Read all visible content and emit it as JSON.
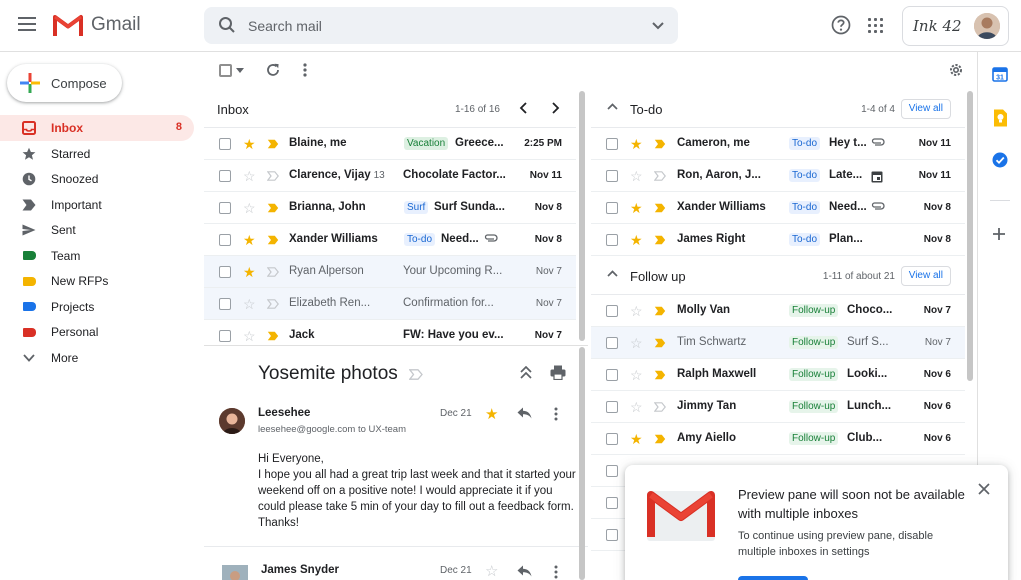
{
  "header": {
    "app_name": "Gmail",
    "search_placeholder": "Search mail",
    "account_brand": "Ink 42"
  },
  "compose_label": "Compose",
  "nav": [
    {
      "label": "Inbox",
      "count": "8",
      "icon": "inbox-icon",
      "active": true
    },
    {
      "label": "Starred",
      "count": "",
      "icon": "star-icon"
    },
    {
      "label": "Snoozed",
      "count": "",
      "icon": "clock-icon"
    },
    {
      "label": "Important",
      "count": "",
      "icon": "important-icon"
    },
    {
      "label": "Sent",
      "count": "",
      "icon": "send-icon"
    },
    {
      "label": "Team",
      "count": "",
      "icon": "label-icon",
      "color": "#188038"
    },
    {
      "label": "New RFPs",
      "count": "",
      "icon": "label-icon",
      "color": "#f4b400"
    },
    {
      "label": "Projects",
      "count": "",
      "icon": "label-icon",
      "color": "#1a73e8"
    },
    {
      "label": "Personal",
      "count": "",
      "icon": "label-icon",
      "color": "#d93025"
    },
    {
      "label": "More",
      "count": "",
      "icon": "chevron-down-icon"
    }
  ],
  "inbox": {
    "title": "Inbox",
    "pager": "1-16 of 16",
    "rows": [
      {
        "sender": "Blaine, me",
        "count": "",
        "label": "Vacation",
        "label_type": "vacation",
        "subject": "Greece...",
        "date": "2:25 PM",
        "starred": true,
        "important": true,
        "unread": true,
        "attachment": false
      },
      {
        "sender": "Clarence, Vijay",
        "count": "13",
        "label": "",
        "label_type": "",
        "subject": "Chocolate Factor...",
        "date": "Nov 11",
        "starred": false,
        "important": false,
        "unread": true,
        "attachment": false
      },
      {
        "sender": "Brianna, John",
        "count": "",
        "label": "Surf",
        "label_type": "surf",
        "subject": "Surf Sunda...",
        "date": "Nov 8",
        "starred": false,
        "important": true,
        "unread": true,
        "attachment": false
      },
      {
        "sender": "Xander Williams",
        "count": "",
        "label": "To-do",
        "label_type": "todo",
        "subject": "Need...",
        "date": "Nov 8",
        "starred": true,
        "important": true,
        "unread": true,
        "attachment": true
      },
      {
        "sender": "Ryan Alperson",
        "count": "",
        "label": "",
        "label_type": "",
        "subject": "Your Upcoming R...",
        "date": "Nov 7",
        "starred": true,
        "important": false,
        "unread": false,
        "attachment": false
      },
      {
        "sender": "Elizabeth Ren...",
        "count": "",
        "label": "",
        "label_type": "",
        "subject": "Confirmation for...",
        "date": "Nov 7",
        "starred": false,
        "important": false,
        "unread": false,
        "attachment": false
      },
      {
        "sender": "Jack",
        "count": "",
        "label": "",
        "label_type": "",
        "subject": "FW: Have you ev...",
        "date": "Nov 7",
        "starred": false,
        "important": true,
        "unread": true,
        "attachment": false
      }
    ]
  },
  "preview": {
    "title": "Yosemite photos",
    "msg1": {
      "from": "Leesehee",
      "address": "leesehee@google.com to UX-team",
      "date": "Dec 21",
      "body": "Hi Everyone,\nI hope you all had a great trip last week and that it started your weekend off on a positive note! I would appreciate it if you could please take 5 min of your day to fill out a feedback form. Thanks!"
    },
    "msg2": {
      "from": "James Snyder",
      "date": "Dec 21"
    }
  },
  "todo": {
    "title": "To-do",
    "pager": "1-4 of 4",
    "view_all": "View all",
    "rows": [
      {
        "sender": "Cameron, me",
        "label": "To-do",
        "label_type": "todo",
        "subject": "Hey t...",
        "date": "Nov 11",
        "starred": true,
        "important": true,
        "unread": true,
        "extra": "attachment"
      },
      {
        "sender": "Ron, Aaron, J...",
        "label": "To-do",
        "label_type": "todo",
        "subject": "Late...",
        "date": "Nov 11",
        "starred": false,
        "important": false,
        "unread": true,
        "extra": "calendar"
      },
      {
        "sender": "Xander Williams",
        "label": "To-do",
        "label_type": "todo",
        "subject": "Need...",
        "date": "Nov 8",
        "starred": true,
        "important": true,
        "unread": true,
        "extra": "attachment"
      },
      {
        "sender": "James Right",
        "label": "To-do",
        "label_type": "todo",
        "subject": "Plan...",
        "date": "Nov 8",
        "starred": true,
        "important": true,
        "unread": true,
        "extra": ""
      }
    ]
  },
  "followup": {
    "title": "Follow up",
    "pager": "1-11 of about 21",
    "view_all": "View all",
    "rows": [
      {
        "sender": "Molly Van",
        "label": "Follow-up",
        "label_type": "follow",
        "subject": "Choco...",
        "date": "Nov 7",
        "starred": false,
        "important": true,
        "unread": true
      },
      {
        "sender": "Tim Schwartz",
        "label": "Follow-up",
        "label_type": "follow",
        "subject": "Surf S...",
        "date": "Nov 7",
        "starred": false,
        "important": true,
        "unread": false
      },
      {
        "sender": "Ralph Maxwell",
        "label": "Follow-up",
        "label_type": "follow",
        "subject": "Looki...",
        "date": "Nov 6",
        "starred": false,
        "important": true,
        "unread": true
      },
      {
        "sender": "Jimmy Tan",
        "label": "Follow-up",
        "label_type": "follow",
        "subject": "Lunch...",
        "date": "Nov 6",
        "starred": false,
        "important": false,
        "unread": true
      },
      {
        "sender": "Amy Aiello",
        "label": "Follow-up",
        "label_type": "follow",
        "subject": "Club...",
        "date": "Nov 6",
        "starred": true,
        "important": true,
        "unread": true
      }
    ]
  },
  "toast": {
    "title": "Preview pane will soon not be available with multiple inboxes",
    "body": "To continue using preview pane, disable multiple inboxes in settings"
  },
  "colors": {
    "accent_red": "#d93025",
    "star": "#f4b400",
    "important": "#f4b400",
    "link_blue": "#1a73e8"
  }
}
